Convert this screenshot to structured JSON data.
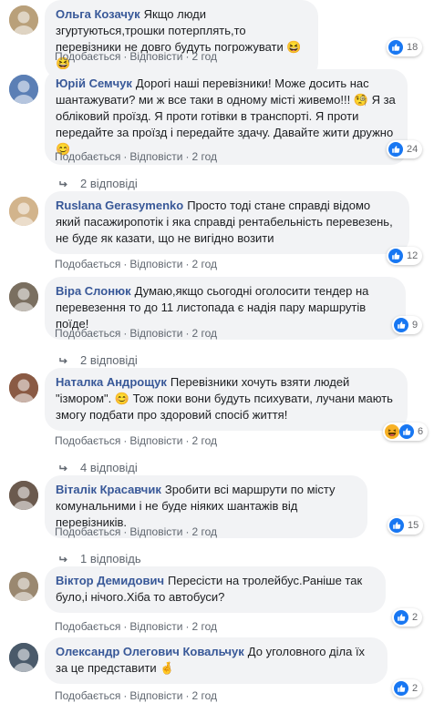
{
  "actions": {
    "like": "Подобається",
    "reply": "Відповісти",
    "dot": "·"
  },
  "colors": {
    "author": "#385898",
    "bubble": "#f2f3f5",
    "like_blue": "#1877f2",
    "haha_yellow": "#f7b125"
  },
  "comments": [
    {
      "author": "Ольга Козачук",
      "text": "Якщо люди згуртуються,трошки потерплять,то перевізники не довго будуть погрожувати 😆😆",
      "time": "2 год",
      "reactions": "18",
      "reaction_icons": [
        "like-icon"
      ]
    },
    {
      "author": "Юрій Семчук",
      "text": "Дорогі наші перевізники! Може досить нас шантажувати? ми ж все таки в одному місті живемо!!! 🧐 Я за обліковий проїзд. Я проти готівки в транспорті. Я проти передайте за проїзд і передайте здачу. Давайте жити дружно 😊",
      "time": "2 год",
      "reactions": "24",
      "reaction_icons": [
        "like-icon"
      ],
      "replies": "2 відповіді"
    },
    {
      "author": "Ruslana Gerasymenko",
      "text": "Просто тоді стане справді відомо який пасажиропотік і яка справді рентабельність перевезень, не буде як казати, що не вигідно возити",
      "time": "2 год",
      "reactions": "12",
      "reaction_icons": [
        "like-icon"
      ]
    },
    {
      "author": "Віра Слонюк",
      "text": "Думаю,якщо сьогодні оголосити тендер на перевезення то до 11 листопада є надія пару маршрутів поїде!",
      "time": "2 год",
      "reactions": "9",
      "reaction_icons": [
        "like-icon"
      ],
      "replies": "2 відповіді"
    },
    {
      "author": "Наталка Андрощук",
      "text": "Перевізники хочуть взяти людей \"ізмором\". 😊 Тож поки вони будуть психувати, лучани мають змогу подбати про здоровий спосіб життя!",
      "time": "2 год",
      "reactions": "6",
      "reaction_icons": [
        "haha-icon",
        "like-icon"
      ],
      "replies": "4 відповіді"
    },
    {
      "author": "Віталік Красавчик",
      "text": "Зробити всі маршрути по місту комунальними і не буде ніяких шантажів від перевізників.",
      "time": "2 год",
      "reactions": "15",
      "reaction_icons": [
        "like-icon"
      ],
      "replies": "1 відповідь"
    },
    {
      "author": "Віктор Демидович",
      "text": "Пересісти на тролейбус.Раніше так було,і нічого.Хіба то автобуси?",
      "time": "2 год",
      "reactions": "2",
      "reaction_icons": [
        "like-icon"
      ]
    },
    {
      "author": "Олександр Олегович Ковальчук",
      "text": "До уголовного діла їх за це представити 🤞",
      "time": "2 год",
      "reactions": "2",
      "reaction_icons": [
        "like-icon"
      ]
    }
  ]
}
